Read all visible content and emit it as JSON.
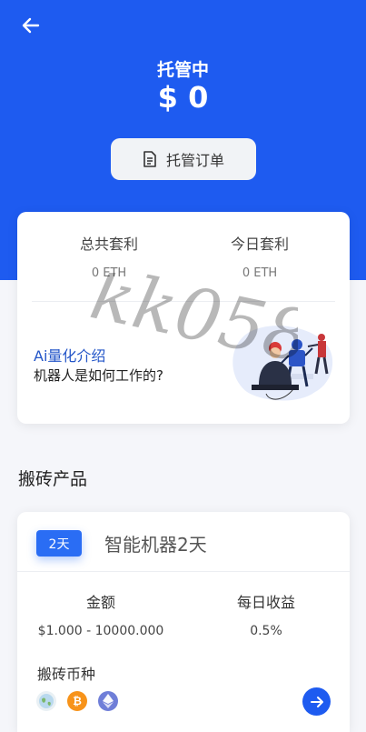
{
  "header": {
    "status_title": "托管中",
    "amount": "$ 0",
    "order_button_label": "托管订单"
  },
  "stats": {
    "total": {
      "label": "总共套利",
      "value": "0 ETH"
    },
    "today": {
      "label": "今日套利",
      "value": "0 ETH"
    }
  },
  "ai_intro": {
    "title": "Ai量化介绍",
    "subtitle": "机器人是如何工作的?"
  },
  "watermark": "kk058",
  "section": {
    "title": "搬砖产品"
  },
  "product": {
    "days_badge": "2天",
    "name": "智能机器2天",
    "amount_label": "金额",
    "amount_value": "$1.000 - 10000.000",
    "daily_label": "每日收益",
    "daily_value": "0.5%",
    "coins_label": "搬砖币种",
    "coins": [
      "globe-icon",
      "bitcoin-icon",
      "ethereum-icon"
    ]
  },
  "colors": {
    "primary": "#1e5bf0",
    "accent_text": "#2456c8",
    "badge": "#2a6df4",
    "bitcoin": "#f7931a",
    "ethereum": "#6f7ed8"
  }
}
